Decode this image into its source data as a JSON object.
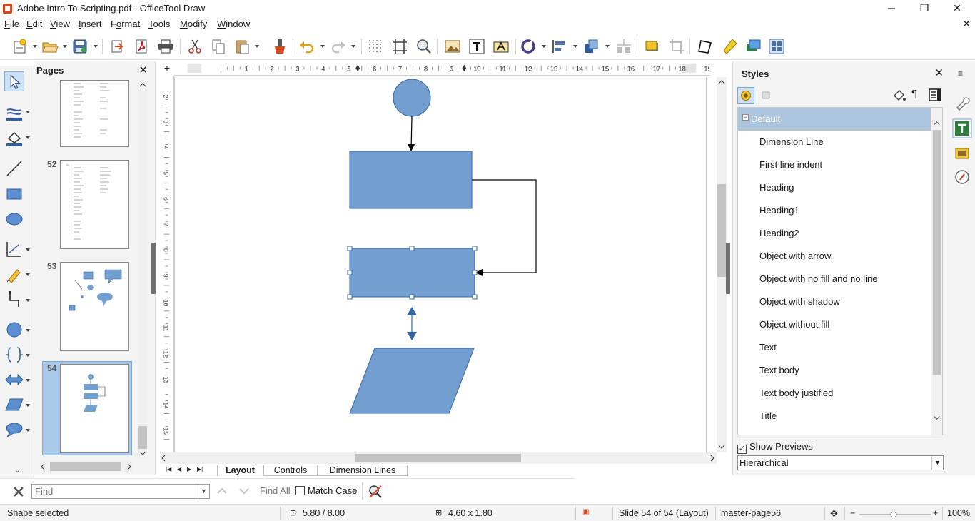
{
  "window": {
    "title": "Adobe Intro To Scripting.pdf - OfficeTool Draw",
    "minimize": "─",
    "maximize": "❐",
    "close": "✕",
    "doc_close": "✕"
  },
  "menu": [
    {
      "pre": "",
      "u": "F",
      "post": "ile"
    },
    {
      "pre": "",
      "u": "E",
      "post": "dit"
    },
    {
      "pre": "",
      "u": "V",
      "post": "iew"
    },
    {
      "pre": "",
      "u": "I",
      "post": "nsert"
    },
    {
      "pre": "F",
      "u": "o",
      "post": "rmat"
    },
    {
      "pre": "",
      "u": "T",
      "post": "ools"
    },
    {
      "pre": "",
      "u": "M",
      "post": "odify"
    },
    {
      "pre": "",
      "u": "W",
      "post": "indow"
    }
  ],
  "pages_panel": {
    "title": "Pages",
    "close": "✕",
    "pages": [
      {
        "number": "52"
      },
      {
        "number": "53"
      },
      {
        "number": "54"
      }
    ],
    "selected_page": "54"
  },
  "ruler": {
    "h_labels": [
      "1",
      "2",
      "3",
      "4",
      "5",
      "6",
      "7",
      "8",
      "9",
      "10",
      "11",
      "12",
      "13",
      "14",
      "15",
      "16",
      "17",
      "18",
      "19"
    ],
    "v_labels": [
      "2",
      "3",
      "4",
      "5",
      "6",
      "7",
      "8",
      "9",
      "10",
      "11",
      "12",
      "13",
      "14",
      "15"
    ]
  },
  "layer_tabs": [
    {
      "label": "Layout",
      "active": true
    },
    {
      "label": "Controls",
      "active": false
    },
    {
      "label": "Dimension Lines",
      "active": false
    }
  ],
  "styles_panel": {
    "title": "Styles",
    "close": "✕",
    "group": "Default",
    "items": [
      "Dimension Line",
      "First line indent",
      "Heading",
      "Heading1",
      "Heading2",
      "Object with arrow",
      "Object with no fill and no line",
      "Object with shadow",
      "Object without fill",
      "Text",
      "Text body",
      "Text body justified",
      "Title"
    ],
    "show_previews_label": "Show Previews",
    "show_previews_checked": true,
    "filter_value": "Hierarchical"
  },
  "find_bar": {
    "placeholder": "Find",
    "find_all": "Find All",
    "match_case": "Match Case"
  },
  "status": {
    "message": "Shape selected",
    "position": "5.80 / 8.00",
    "size": "4.60 x 1.80",
    "slide": "Slide 54 of 54 (Layout)",
    "master": "master-page56",
    "zoom": "100%"
  },
  "colors": {
    "shape_fill": "#729fcf",
    "shape_stroke": "#3465a4",
    "selection_handle": "#3465a4",
    "selected_row": "#aec6dd",
    "title_icon": "#d9481d"
  },
  "icons": {
    "toolbar": [
      "new-icon",
      "open-icon",
      "save-icon",
      "export-icon",
      "export-pdf-icon",
      "print-icon",
      "cut-icon",
      "copy-icon",
      "paste-icon",
      "clone-formatting-icon",
      "undo-icon",
      "redo-icon",
      "grid-icon",
      "helplines-icon",
      "zoom-pan-icon",
      "image-icon",
      "text-box-icon",
      "fontwork-icon",
      "rotate-icon",
      "align-icon",
      "arrange-icon",
      "distribute-icon",
      "shadow-icon",
      "crop-icon",
      "points-icon",
      "glue-points-icon",
      "insert-3d-icon",
      "select-all-icon"
    ],
    "left_tools": [
      "select-icon",
      "line-color-icon",
      "fill-color-icon",
      "line-icon",
      "rectangle-icon",
      "ellipse-icon",
      "lines-arrows-icon",
      "curve-icon",
      "connector-icon",
      "basic-shapes-icon",
      "symbol-shapes-icon",
      "block-arrows-icon",
      "flowchart-icon",
      "callouts-icon"
    ]
  }
}
